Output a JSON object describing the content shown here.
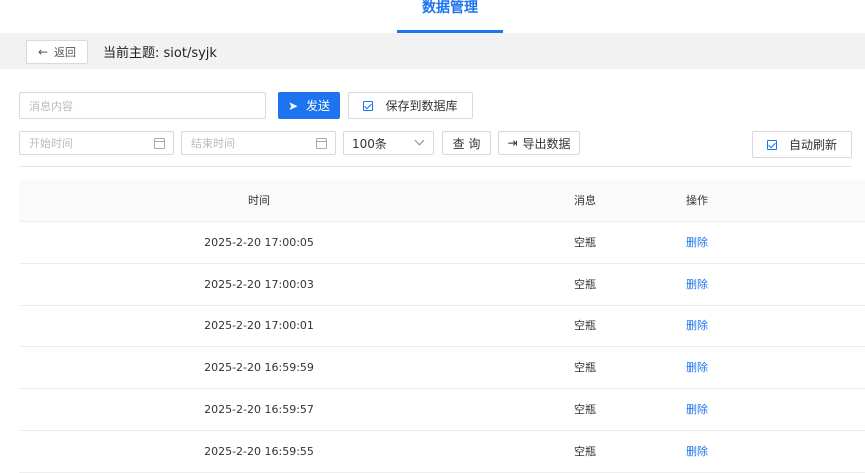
{
  "header": {
    "title": "数据管理"
  },
  "subbar": {
    "back_label": "返回",
    "topic": "当前主题: siot/syjk"
  },
  "form": {
    "message_placeholder": "消息内容",
    "send_label": "发送",
    "save_db_label": "保存到数据库",
    "start_time_placeholder": "开始时间",
    "end_time_placeholder": "结束时间",
    "limit_value": "100条",
    "query_label": "查 询",
    "export_label": "导出数据",
    "auto_refresh_label": "自动刷新"
  },
  "table": {
    "headers": {
      "time": "时间",
      "message": "消息",
      "action": "操作"
    },
    "rows": [
      {
        "time": "2025-2-20 17:00:05",
        "message": "空瓶",
        "action": "删除"
      },
      {
        "time": "2025-2-20 17:00:03",
        "message": "空瓶",
        "action": "删除"
      },
      {
        "time": "2025-2-20 17:00:01",
        "message": "空瓶",
        "action": "删除"
      },
      {
        "time": "2025-2-20 16:59:59",
        "message": "空瓶",
        "action": "删除"
      },
      {
        "time": "2025-2-20 16:59:57",
        "message": "空瓶",
        "action": "删除"
      },
      {
        "time": "2025-2-20 16:59:55",
        "message": "空瓶",
        "action": "删除"
      }
    ]
  }
}
